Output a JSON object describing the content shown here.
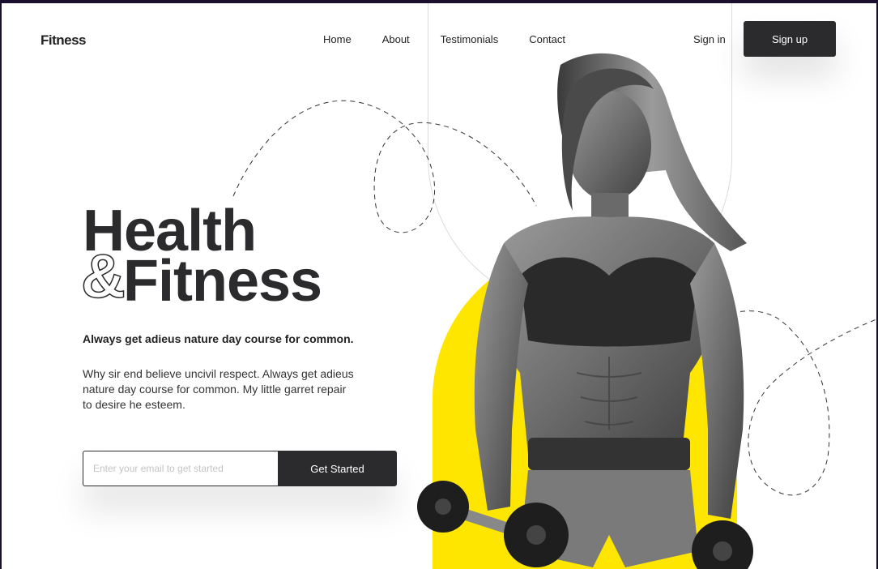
{
  "nav": {
    "logo": "Fitness",
    "links": [
      "Home",
      "About",
      "Testimonials",
      "Contact"
    ],
    "sign_in": "Sign in",
    "sign_up": "Sign up"
  },
  "hero": {
    "title_line1": "Health",
    "ampersand": "&",
    "title_line2": "Fitness",
    "subtitle": "Always get adieus nature day course for common.",
    "body": "Why sir end believe uncivil respect. Always get adieus nature day course for common. My little garret repair to desire he esteem.",
    "email_placeholder": "Enter your email to get started",
    "cta_label": "Get Started"
  },
  "colors": {
    "accent": "#ffe600",
    "dark": "#2b2b2d",
    "frame": "#1a0f2e"
  },
  "images": {
    "hero_model": "athlete-holding-dumbbells"
  }
}
